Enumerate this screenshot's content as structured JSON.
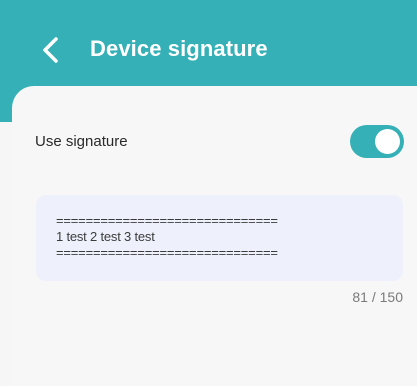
{
  "header": {
    "title": "Device signature",
    "back_icon": "chevron-left-icon",
    "color": "#35b0b6"
  },
  "settings": {
    "use_signature_label": "Use signature",
    "use_signature_enabled": true,
    "toggle_color": "#35b0b6"
  },
  "signature": {
    "text": "==============================\n1 test 2 test 3 test\n==============================",
    "counter": "81 / 150"
  }
}
